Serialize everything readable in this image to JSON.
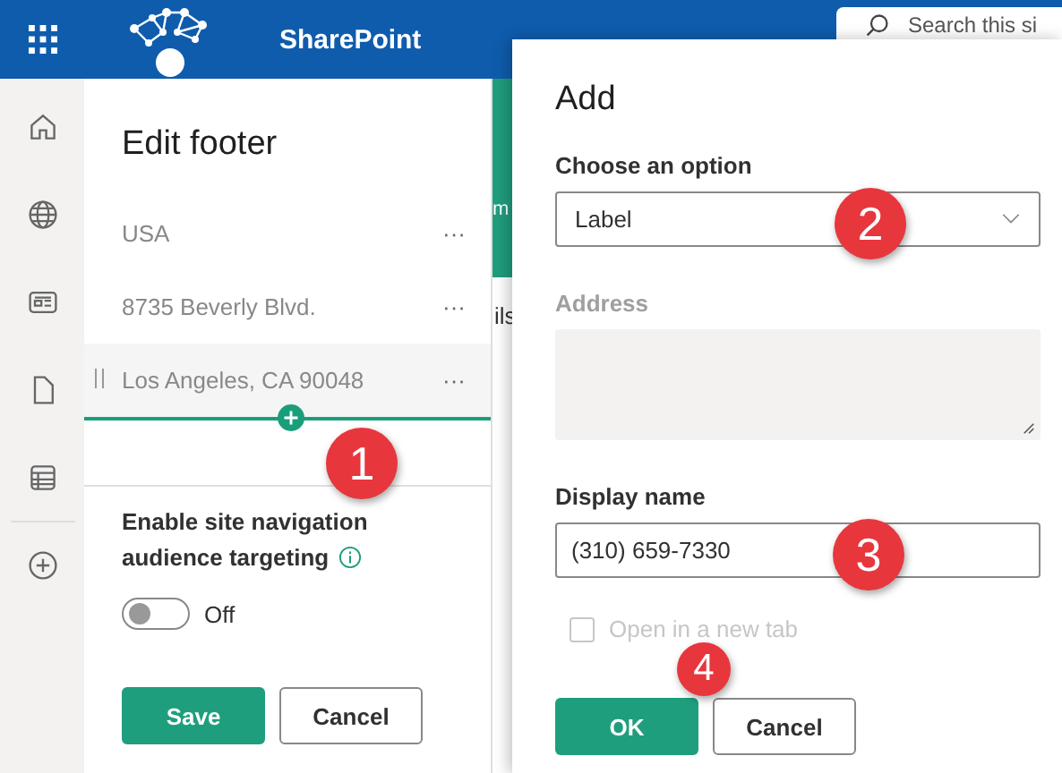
{
  "header": {
    "app_name": "SharePoint",
    "search_placeholder": "Search this si"
  },
  "background_page": {
    "fragments": [
      "m",
      "ils"
    ]
  },
  "footer_panel": {
    "title": "Edit footer",
    "items": [
      {
        "label": "USA",
        "more": "···",
        "selected": false
      },
      {
        "label": "8735 Beverly Blvd.",
        "more": "···",
        "selected": false
      },
      {
        "label": "Los Angeles, CA 90048",
        "more": "···",
        "selected": true
      }
    ],
    "targeting": {
      "label": "Enable site navigation audience targeting",
      "on": false,
      "state_text": "Off"
    },
    "buttons": [
      {
        "label": "Save",
        "kind": "primary"
      },
      {
        "label": "Cancel",
        "kind": "secondary"
      }
    ]
  },
  "dialog": {
    "title": "Add",
    "fields": [
      {
        "kind": "select",
        "label": "Choose an option",
        "value": "Label",
        "disabled": false
      },
      {
        "kind": "textarea",
        "label": "Address",
        "disabled": true
      },
      {
        "kind": "text",
        "label": "Display name",
        "value": "(310) 659-7330",
        "disabled": false
      }
    ],
    "checkbox": {
      "label": "Open in a new tab",
      "checked": false,
      "disabled": true
    },
    "buttons": [
      {
        "label": "OK",
        "kind": "primary"
      },
      {
        "label": "Cancel",
        "kind": "secondary"
      }
    ]
  },
  "annotations": [
    {
      "label": "1"
    },
    {
      "label": "2"
    },
    {
      "label": "3"
    },
    {
      "label": "4"
    }
  ]
}
